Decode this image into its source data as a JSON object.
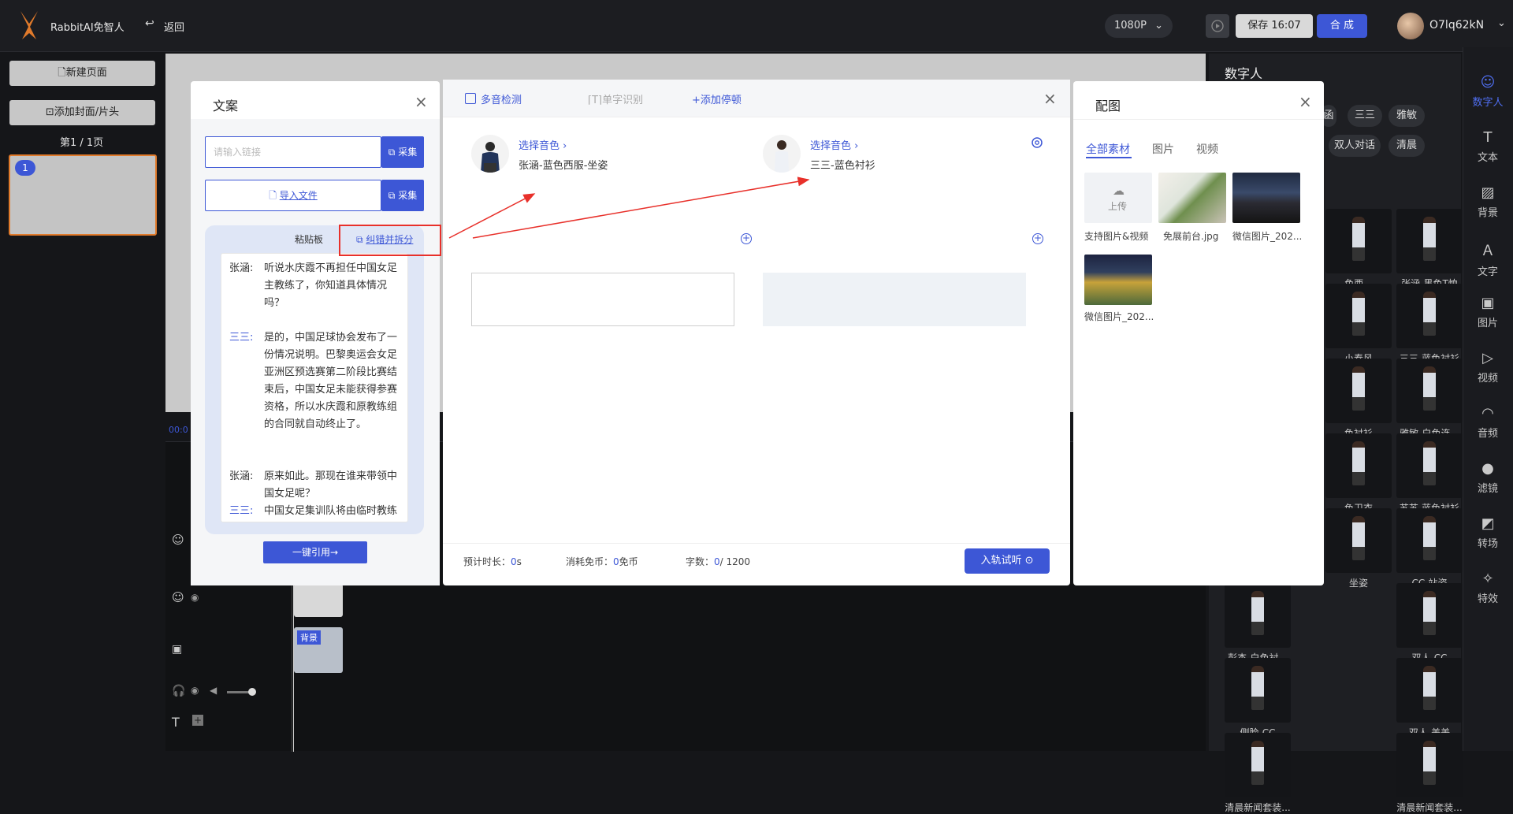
{
  "topbar": {
    "app_name": "RabbitAI免智人",
    "back_label": "返回",
    "resolution": "1080P",
    "save_label": "保存 16:07",
    "compose_label": "合 成",
    "username": "O7lq62kN"
  },
  "left": {
    "new_page": "新建页面",
    "add_cover": "添加封面/片头",
    "page_info": "第1 / 1页",
    "thumb_num": "1"
  },
  "timeline": {
    "time": "00:0",
    "bg_label": "背景"
  },
  "digital_human_panel": {
    "title": "数字人",
    "chips": [
      "函",
      "三三",
      "雅敏",
      "双人对话",
      "清晨"
    ],
    "captions": [
      "色西...",
      "张涵-黑色T恤",
      "小春风",
      "三三-蓝色衬衫",
      "色衬衫",
      "雅敏-白色连...",
      "色卫衣",
      "苏苏-蓝色衬衫",
      "坐姿",
      "CC-站姿",
      "彭杰-白色衬...",
      "双人-CC",
      "侧脸-CC",
      "双人-美美",
      "清晨新闻套装...",
      "清晨新闻套装..."
    ]
  },
  "right_toolbar": [
    {
      "label": "数字人",
      "icon": "person-icon",
      "active": true
    },
    {
      "label": "文本",
      "icon": "text-icon"
    },
    {
      "label": "背景",
      "icon": "background-icon"
    },
    {
      "label": "文字",
      "icon": "letter-icon"
    },
    {
      "label": "图片",
      "icon": "image-icon"
    },
    {
      "label": "视频",
      "icon": "video-icon"
    },
    {
      "label": "音频",
      "icon": "headphone-icon"
    },
    {
      "label": "滤镜",
      "icon": "filter-icon"
    },
    {
      "label": "转场",
      "icon": "transition-icon"
    },
    {
      "label": "特效",
      "icon": "effects-icon"
    }
  ],
  "wenan_modal": {
    "title": "文案",
    "link_placeholder": "请输入链接",
    "collect_label": "采集",
    "import_label": "导入文件",
    "clipboard_label": "粘贴板",
    "correct_split_label": "纠错并拆分",
    "lines": [
      {
        "speaker": "张涵:",
        "text": "听说水庆霞不再担任中国女足主教练了，你知道具体情况吗？"
      },
      {
        "speaker": "三三:",
        "text": "是的，中国足球协会发布了一份情况说明。巴黎奥运会女足亚洲区预选赛第二阶段比赛结束后，中国女足未能获得参赛资格，所以水庆霞和原教练组的合同就自动终止了。"
      },
      {
        "speaker": "张涵:",
        "text": "原来如此。那现在谁来带领中国女足呢？"
      },
      {
        "speaker": "三三:",
        "text": "中国女足集训队将由临时教练组带队，他们将完成接下来全国训练的各项任务。"
      }
    ],
    "quote_label": "一键引用→"
  },
  "script_modal": {
    "multi_tone": "多音检测",
    "single_char": "单字识别",
    "add_pause": "添加停顿",
    "select_voice_label": "选择音色 ›",
    "speaker1": "张涵-蓝色西服-坐姿",
    "speaker2": "三三-蓝色衬衫",
    "est_label": "预计时长：",
    "est_value": "0",
    "est_unit": "s",
    "cost_label": "消耗免币：",
    "cost_value": "0",
    "cost_unit": "免币",
    "chars_label": "字数：",
    "chars_value": "0",
    "chars_max": "/ 1200",
    "try_label": "入轨试听"
  },
  "peitu_modal": {
    "title": "配图",
    "tabs": [
      "全部素材",
      "图片",
      "视频"
    ],
    "upload_label": "上传",
    "upload_caption": "支持图片&视频",
    "images": [
      "免展前台.jpg",
      "微信图片_202...",
      "微信图片_202..."
    ]
  },
  "colors": {
    "accent": "#3d57d6",
    "highlight": "#e8302a",
    "thumb_border": "#e07a2b"
  }
}
